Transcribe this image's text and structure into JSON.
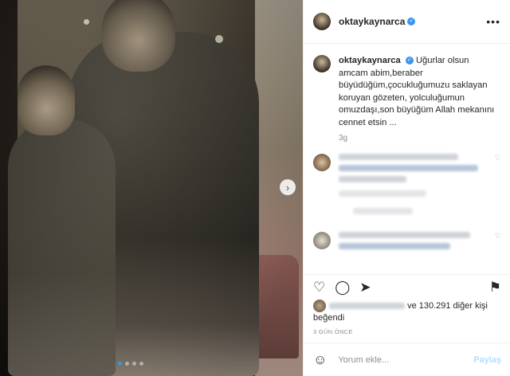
{
  "post": {
    "username": "oktaykaynarca",
    "verified_icon": "verified-badge-icon",
    "more_icon": "more-options-icon",
    "caption": "Uğurlar olsun amcam abim,beraber büyüdüğüm,çocukluğumuzu saklayan koruyan gözeten, yolculuğumun omuzdaşı,son büyüğüm Allah mekanını cennet etsin ...",
    "time": "3g",
    "likes_suffix": "ve 130.291 diğer kişi beğendi",
    "ago": "3 GÜN ÖNCE"
  },
  "actions": {
    "like_icon": "heart-icon",
    "comment_icon": "comment-icon",
    "share_icon": "send-icon",
    "save_icon": "bookmark-icon"
  },
  "comment_box": {
    "placeholder": "Yorum ekle...",
    "post_label": "Paylaş",
    "emoji_icon": "emoji-icon"
  },
  "carousel": {
    "next_icon": "chevron-right-icon",
    "slides": 4,
    "active_slide": 1
  },
  "colors": {
    "accent": "#3897f0",
    "muted": "#8e8e8e",
    "post_disabled": "#b2dffc"
  }
}
